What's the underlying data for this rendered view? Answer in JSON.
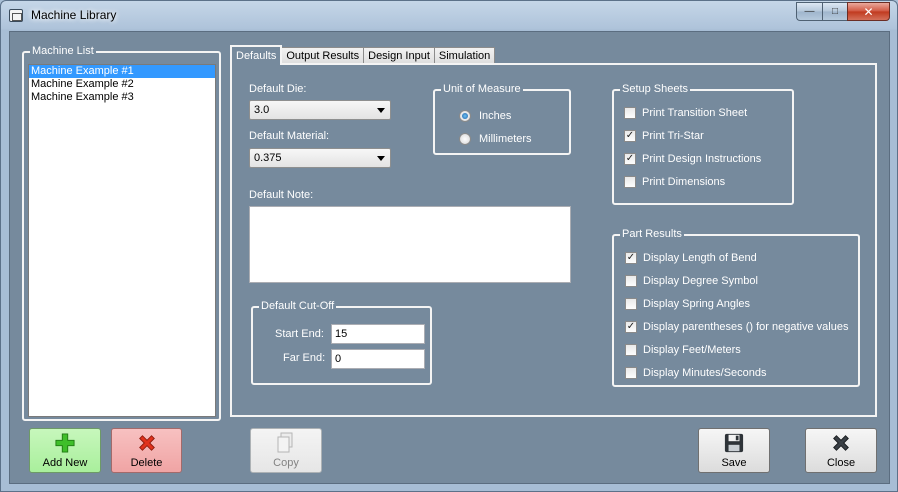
{
  "window": {
    "title": "Machine Library"
  },
  "machine_list": {
    "legend": "Machine List",
    "items": [
      "Machine Example #1",
      "Machine Example #2",
      "Machine Example #3"
    ],
    "selected_index": 0
  },
  "tabs": [
    "Defaults",
    "Output Results",
    "Design Input",
    "Simulation"
  ],
  "active_tab": "Defaults",
  "defaults": {
    "die_label": "Default Die:",
    "die_value": "3.0",
    "material_label": "Default Material:",
    "material_value": "0.375",
    "note_label": "Default Note:",
    "note_value": ""
  },
  "unit_of_measure": {
    "legend": "Unit of Measure",
    "options": [
      {
        "label": "Inches",
        "selected": true
      },
      {
        "label": "Millimeters",
        "selected": false
      }
    ]
  },
  "cutoff": {
    "legend": "Default Cut-Off",
    "start_label": "Start End:",
    "start_value": "15",
    "far_label": "Far End:",
    "far_value": "0"
  },
  "setup_sheets": {
    "legend": "Setup Sheets",
    "items": [
      {
        "label": "Print Transition Sheet",
        "checked": false
      },
      {
        "label": "Print Tri-Star",
        "checked": true
      },
      {
        "label": "Print Design Instructions",
        "checked": true
      },
      {
        "label": "Print Dimensions",
        "checked": false
      }
    ]
  },
  "part_results": {
    "legend": "Part Results",
    "items": [
      {
        "label": "Display Length of Bend",
        "checked": true
      },
      {
        "label": "Display Degree Symbol",
        "checked": false
      },
      {
        "label": "Display Spring Angles",
        "checked": false
      },
      {
        "label": "Display parentheses () for negative values",
        "checked": true
      },
      {
        "label": "Display Feet/Meters",
        "checked": false
      },
      {
        "label": "Display Minutes/Seconds",
        "checked": false
      }
    ]
  },
  "buttons": {
    "add_new": "Add New",
    "delete": "Delete",
    "copy": "Copy",
    "save": "Save",
    "close": "Close"
  },
  "icons": {
    "add": "plus-icon",
    "delete": "x-icon",
    "copy": "copy-icon",
    "save": "floppy-disk-icon",
    "close": "x-icon"
  },
  "colors": {
    "client_bg": "#768a9d",
    "add_button": "#b8f3ac",
    "delete_button": "#f3b2b2",
    "selection": "#3399ff"
  }
}
